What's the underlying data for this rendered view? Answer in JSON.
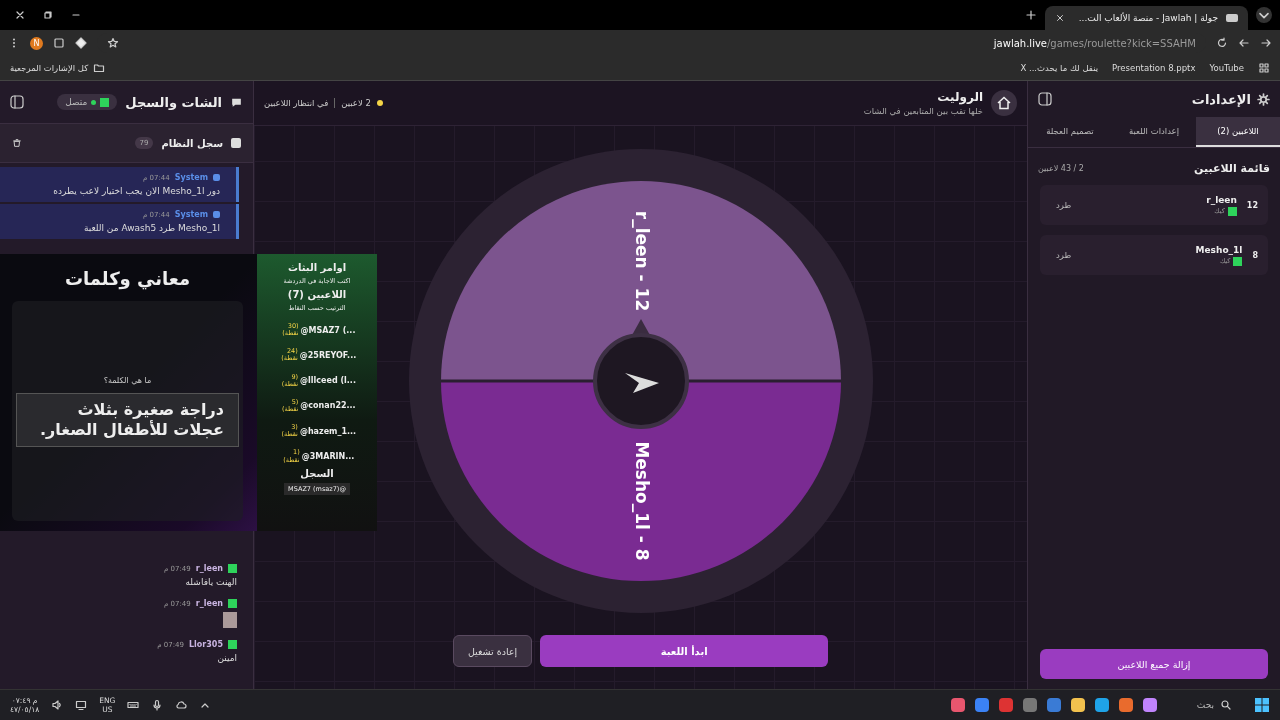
{
  "browser": {
    "tab_title": "جولة | Jawlah - منصة الألعاب الت...",
    "url_host": "jawlah.live",
    "url_path": "/games/roulette?kick=SSAHM",
    "profile_initial": "N",
    "bookmarks_folder": "كل الإشارات المرجعية",
    "bookmarks": [
      "YouTube",
      "Presentation 8.pptx",
      "ينقل لك ما يحدث... X"
    ]
  },
  "chat": {
    "title": "الشات والسجل",
    "status": "متصل",
    "log_title": "سجل النظام",
    "log_count": "79",
    "messages": [
      {
        "kind": "system",
        "author": "System",
        "time": "07:44 م",
        "text": "دور Mesho_1l الان يجب اختيار لاعب يطرده"
      },
      {
        "kind": "system",
        "author": "System",
        "time": "07:44 م",
        "text": "Mesho_1l طرد Awash5 من اللعبة"
      },
      {
        "kind": "text",
        "author": "r_leen",
        "time": "07:49 م",
        "text": "الهنت يافاشله"
      },
      {
        "kind": "sticker",
        "author": "r_leen",
        "time": "07:49 م"
      },
      {
        "kind": "text",
        "author": "Llor305",
        "time": "07:49 م",
        "text": "امينن"
      }
    ]
  },
  "overlay": {
    "title": "معاني وكلمات",
    "question": "ما هي الكلمة؟",
    "answer": "دراجة صغيرة بثلاث عجلات للأطفال الصغار.",
    "commands_title": "اوامر البثاث",
    "commands_hint": "اكتب الاجابة في الدردشة",
    "players_title": "اللاعبين (7)",
    "sort_hint": "الترتيب حسب النقاط",
    "leaders": [
      {
        "name": "@MSAZ7 (...",
        "points": "(30 نقطة)"
      },
      {
        "name": "@25REYOF...",
        "points": "(24 نقطة)"
      },
      {
        "name": "@lllceed (l...",
        "points": "(9 نقطة)"
      },
      {
        "name": "@conan22...",
        "points": "(5 نقطة)"
      },
      {
        "name": "@hazem_1...",
        "points": "(3 نقطة)"
      },
      {
        "name": "@3MARIN...",
        "points": "(1 نقطة)"
      }
    ],
    "log_title": "السجل",
    "log_entry": "MSAZ7 (msaz7)@"
  },
  "game": {
    "title": "الروليت",
    "subtitle": "خلها تقب بين المتابعين في الشات",
    "players_count": "2 لاعبين",
    "status": "في انتظار اللاعبين",
    "segments": [
      {
        "label": "r_leen - 12",
        "color": "#7c548e"
      },
      {
        "label": "Mesho_1l - 8",
        "color": "#7a2b92"
      }
    ],
    "start_button": "ابدأ اللعبة",
    "restart_button": "إعادة تشغيل"
  },
  "settings": {
    "title": "الإعدادات",
    "tabs": [
      {
        "label": "اللاعبين (2)",
        "selected": true
      },
      {
        "label": "إعدادات اللعبة",
        "selected": false
      },
      {
        "label": "تصميم العجلة",
        "selected": false
      }
    ],
    "list_title": "قائمة اللاعبين",
    "list_count": "2 / 43 لاعبين",
    "players": [
      {
        "score": "12",
        "name": "r_leen",
        "platform": "كيك",
        "action": "طرد"
      },
      {
        "score": "8",
        "name": "Mesho_1l",
        "platform": "كيك",
        "action": "طرد"
      }
    ],
    "remove_all": "إزالة جميع اللاعبين"
  },
  "taskbar": {
    "search": "بحث",
    "lang_top": "ENG",
    "lang_bottom": "US",
    "time": "م ٠٧:٤٩",
    "date": "٤٧/٠٥/١٨"
  }
}
